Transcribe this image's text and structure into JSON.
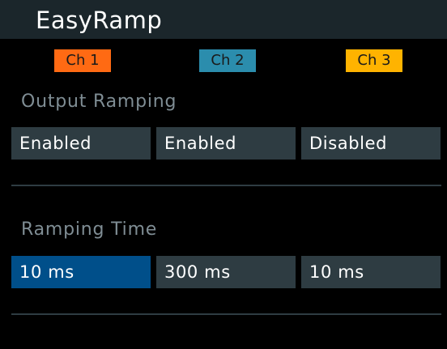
{
  "app": {
    "title": "EasyRamp"
  },
  "channels": [
    {
      "label": "Ch 1",
      "color": "#ff6a13"
    },
    {
      "label": "Ch 2",
      "color": "#2b8dad"
    },
    {
      "label": "Ch 3",
      "color": "#ffb300"
    }
  ],
  "output_ramping": {
    "label": "Output Ramping",
    "values": [
      "Enabled",
      "Enabled",
      "Disabled"
    ]
  },
  "ramping_time": {
    "label": "Ramping Time",
    "values": [
      "10 ms",
      "300 ms",
      "10 ms"
    ],
    "selected_index": 0
  },
  "colors": {
    "background": "#000000",
    "title_bar": "#1b262b",
    "cell": "#2e3c42",
    "selected": "#004f8a",
    "section_label": "#7f8d94"
  }
}
